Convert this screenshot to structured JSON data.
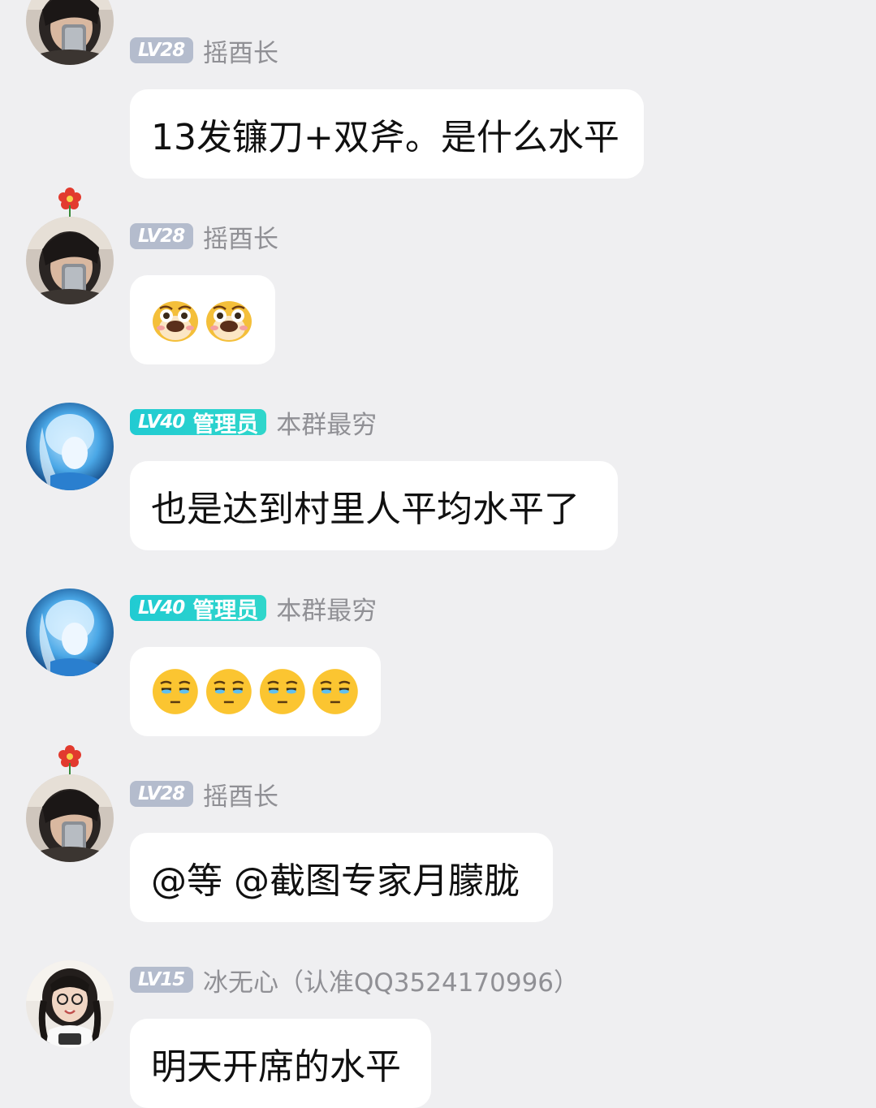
{
  "messages": [
    {
      "id": 1,
      "avatar_type": "dark-boy",
      "has_flower": true,
      "level": "LV28",
      "role": "",
      "name": "摇酉长",
      "text": "13发镰刀+双斧。是什么水平",
      "bubble_width": 633
    },
    {
      "id": 2,
      "avatar_type": "dark-boy",
      "has_flower": true,
      "level": "LV28",
      "role": "",
      "name": "摇酉长",
      "emojis": [
        "dog-tearful-emoji",
        "dog-tearful-emoji"
      ],
      "bubble_width": 179
    },
    {
      "id": 3,
      "avatar_type": "blue-anime-girl",
      "has_flower": false,
      "level": "LV40",
      "role": "管理员",
      "name": "本群最穷",
      "text": "也是达到村里人平均水平了",
      "bubble_width": 601
    },
    {
      "id": 4,
      "avatar_type": "blue-anime-girl",
      "has_flower": false,
      "level": "LV40",
      "role": "管理员",
      "name": "本群最穷",
      "emojis": [
        "unamused-face-emoji",
        "unamused-face-emoji",
        "unamused-face-emoji",
        "unamused-face-emoji"
      ],
      "bubble_width": 309
    },
    {
      "id": 5,
      "avatar_type": "dark-boy",
      "has_flower": true,
      "level": "LV28",
      "role": "",
      "name": "摇酉长",
      "text": "@等 @截图专家月朦胧",
      "bubble_width": 521
    },
    {
      "id": 6,
      "avatar_type": "girl-glasses",
      "has_flower": false,
      "level": "LV15",
      "role": "",
      "name": "冰无心（认准QQ3524170996）",
      "text": "明天开席的水平",
      "bubble_width": 371
    }
  ],
  "colors": {
    "background": "#efeff1",
    "bubble": "#ffffff",
    "name_grey": "#909095",
    "level_grey": "#b4bccd",
    "admin_teal": "#22ccd1"
  }
}
